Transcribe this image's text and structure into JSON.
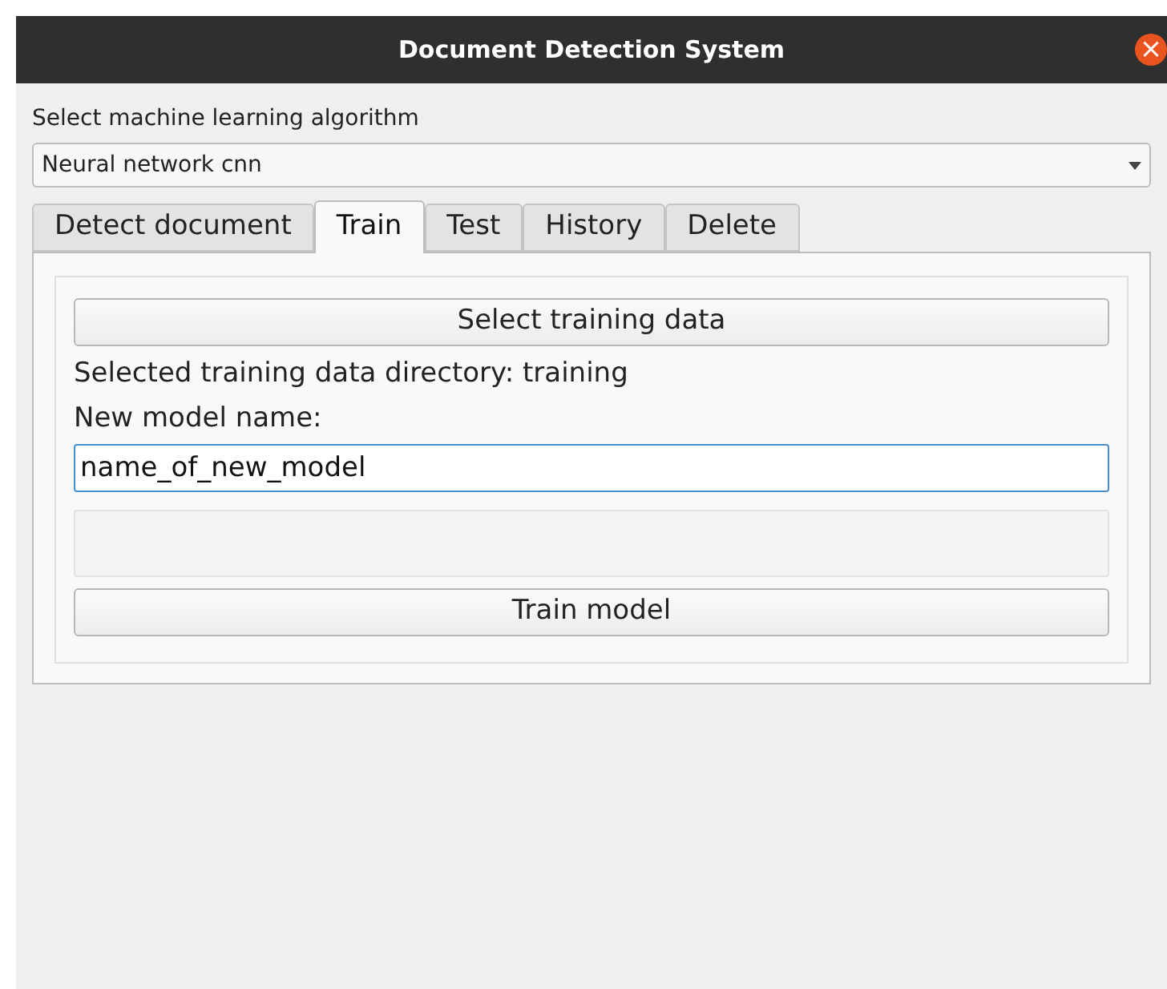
{
  "window": {
    "title": "Document Detection System",
    "close_icon": "×"
  },
  "algorithm": {
    "label": "Select machine learning algorithm",
    "value": "Neural network cnn"
  },
  "tabs": [
    {
      "label": "Detect document",
      "selected": false
    },
    {
      "label": "Train",
      "selected": true
    },
    {
      "label": "Test",
      "selected": false
    },
    {
      "label": "History",
      "selected": false
    },
    {
      "label": "Delete",
      "selected": false
    }
  ],
  "train": {
    "select_button": "Select training data",
    "directory_text": "Selected training data directory: training",
    "name_label": "New model name:",
    "name_value": "name_of_new_model",
    "progress": {
      "level": 0
    },
    "train_button": "Train model"
  }
}
